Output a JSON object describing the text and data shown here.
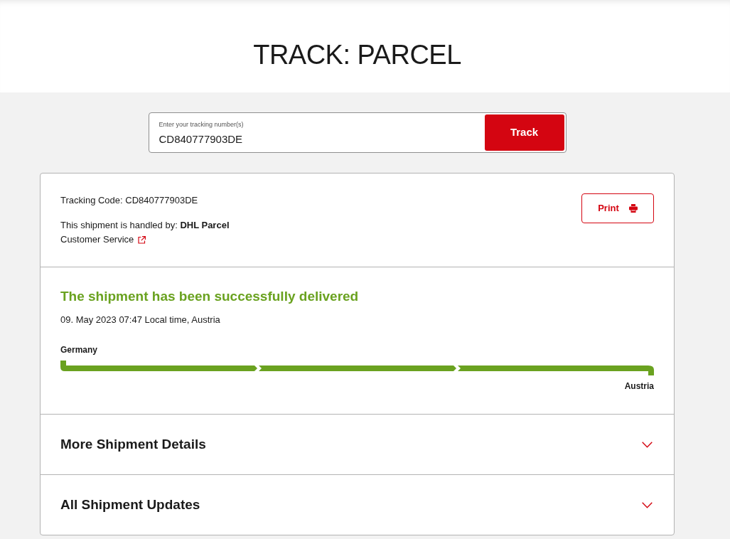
{
  "header": {
    "title": "TRACK: PARCEL"
  },
  "search": {
    "label": "Enter your tracking number(s)",
    "value": "CD840777903DE",
    "button": "Track"
  },
  "shipment": {
    "tracking_code": "Tracking Code: CD840777903DE",
    "handled_by": "This shipment is handled by: **DHL Parcel**",
    "customer_service_link": "Customer Service",
    "print_button": "Print"
  },
  "status": {
    "kind": "delivered",
    "message": "The shipment has been successfully delivered",
    "timestamp": "09. May 2023 07:47 Local time, Austria"
  },
  "route": {
    "origin": "Germany",
    "destination": "Austria",
    "level": 1
  },
  "sections": [
    {
      "title": "More Shipment Details",
      "expanded": false
    },
    {
      "title": "All Shipment Updates",
      "expanded": false
    }
  ]
}
